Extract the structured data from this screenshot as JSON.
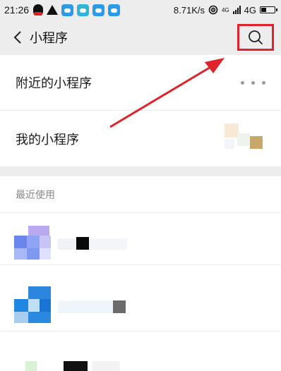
{
  "status_bar": {
    "time": "21:26",
    "speed": "8.71K/s",
    "network": "4G",
    "network_small": "4G"
  },
  "header": {
    "title": "小程序",
    "search_icon": "search-icon",
    "back_icon": "chevron-left-icon"
  },
  "menu": {
    "items": [
      {
        "label": "附近的小程序",
        "icon": "more-dots-icon"
      },
      {
        "label": "我的小程序",
        "icon": "mini-program-thumbnail"
      }
    ]
  },
  "recent": {
    "section_label": "最近使用"
  },
  "colors": {
    "highlight": "#e0222a",
    "background_gray": "#ededed",
    "divider": "#ececec"
  }
}
